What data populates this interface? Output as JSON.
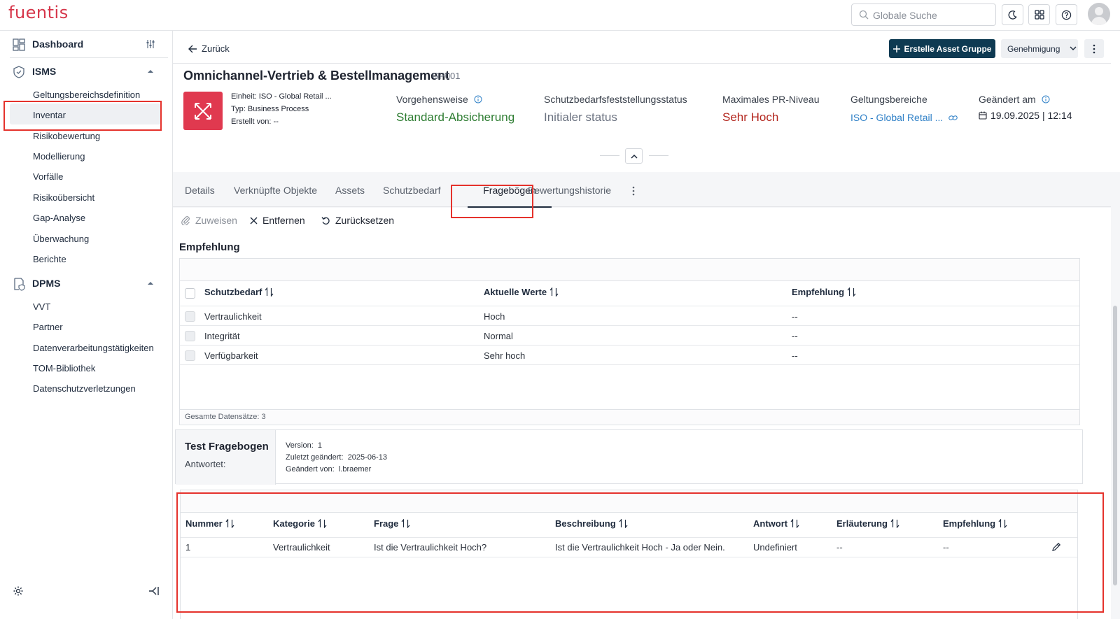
{
  "app": {
    "logo": "fuentis"
  },
  "topbar": {
    "search_placeholder": "Globale Suche"
  },
  "sidebar": {
    "dashboard": "Dashboard",
    "isms": {
      "label": "ISMS",
      "items": [
        "Geltungsbereichsdefinition",
        "Inventar",
        "Risikobewertung",
        "Modellierung",
        "Vorfälle",
        "Risikoübersicht",
        "Gap-Analyse",
        "Überwachung",
        "Berichte"
      ]
    },
    "dpms": {
      "label": "DPMS",
      "items": [
        "VVT",
        "Partner",
        "Datenverarbeitungstätigkeiten",
        "TOM-Bibliothek",
        "Datenschutzverletzungen"
      ]
    },
    "active_item": "Inventar"
  },
  "header": {
    "back": "Zurück",
    "create_button": "Erstelle Asset Gruppe",
    "approval_dropdown": "Genehmigung"
  },
  "asset": {
    "title": "Omnichannel-Vertrieb & Bestellmanagement",
    "code": "GP001",
    "einheit_label": "Einheit:",
    "einheit_value": "ISO - Global Retail ...",
    "typ_label": "Typ:",
    "typ_value": "Business Process",
    "erstellt_label": "Erstellt von:",
    "erstellt_value": "--",
    "columns": {
      "vorgehensweise": {
        "label": "Vorgehensweise",
        "value": "Standard-Absicherung"
      },
      "status": {
        "label": "Schutzbedarfsfeststellungsstatus",
        "value": "Initialer status"
      },
      "pr_niveau": {
        "label": "Maximales PR-Niveau",
        "value": "Sehr Hoch"
      },
      "geltungsbereiche": {
        "label": "Geltungsbereiche",
        "value": "ISO - Global Retail ..."
      },
      "geaendert": {
        "label": "Geändert am",
        "value": "19.09.2025 | 12:14"
      }
    }
  },
  "tabs": [
    "Details",
    "Verknüpfte Objekte",
    "Assets",
    "Schutzbedarf",
    "Fragebögen",
    "Bewertungshistorie"
  ],
  "active_tab": "Fragebögen",
  "actions": {
    "assign": "Zuweisen",
    "remove": "Entfernen",
    "reset": "Zurücksetzen"
  },
  "recommendation": {
    "title": "Empfehlung",
    "headers": [
      "Schutzbedarf",
      "Aktuelle Werte",
      "Empfehlung"
    ],
    "rows": [
      [
        "Vertraulichkeit",
        "Hoch",
        "--"
      ],
      [
        "Integrität",
        "Normal",
        "--"
      ],
      [
        "Verfügbarkeit",
        "Sehr hoch",
        "--"
      ]
    ],
    "footer": "Gesamte Datensätze: 3"
  },
  "questionnaire": {
    "title": "Test Fragebogen",
    "answered_label": "Antwortet:",
    "version_label": "Version:",
    "version_value": "1",
    "changed_label": "Zuletzt geändert:",
    "changed_value": "2025-06-13",
    "changed_by_label": "Geändert von:",
    "changed_by_value": "l.braemer",
    "headers": [
      "Nummer",
      "Kategorie",
      "Frage",
      "Beschreibung",
      "Antwort",
      "Erläuterung",
      "Empfehlung"
    ],
    "rows": [
      [
        "1",
        "Vertraulichkeit",
        "Ist die Vertraulichkeit Hoch?",
        "Ist die Vertraulichkeit Hoch - Ja oder Nein.",
        "Undefiniert",
        "--",
        "--"
      ]
    ]
  },
  "colors": {
    "brand": "#d6364a",
    "primary": "#0e3a52",
    "green": "#2e7d32",
    "red": "#b3261e",
    "link": "#2f80c7",
    "highlight": "#e5322c"
  }
}
